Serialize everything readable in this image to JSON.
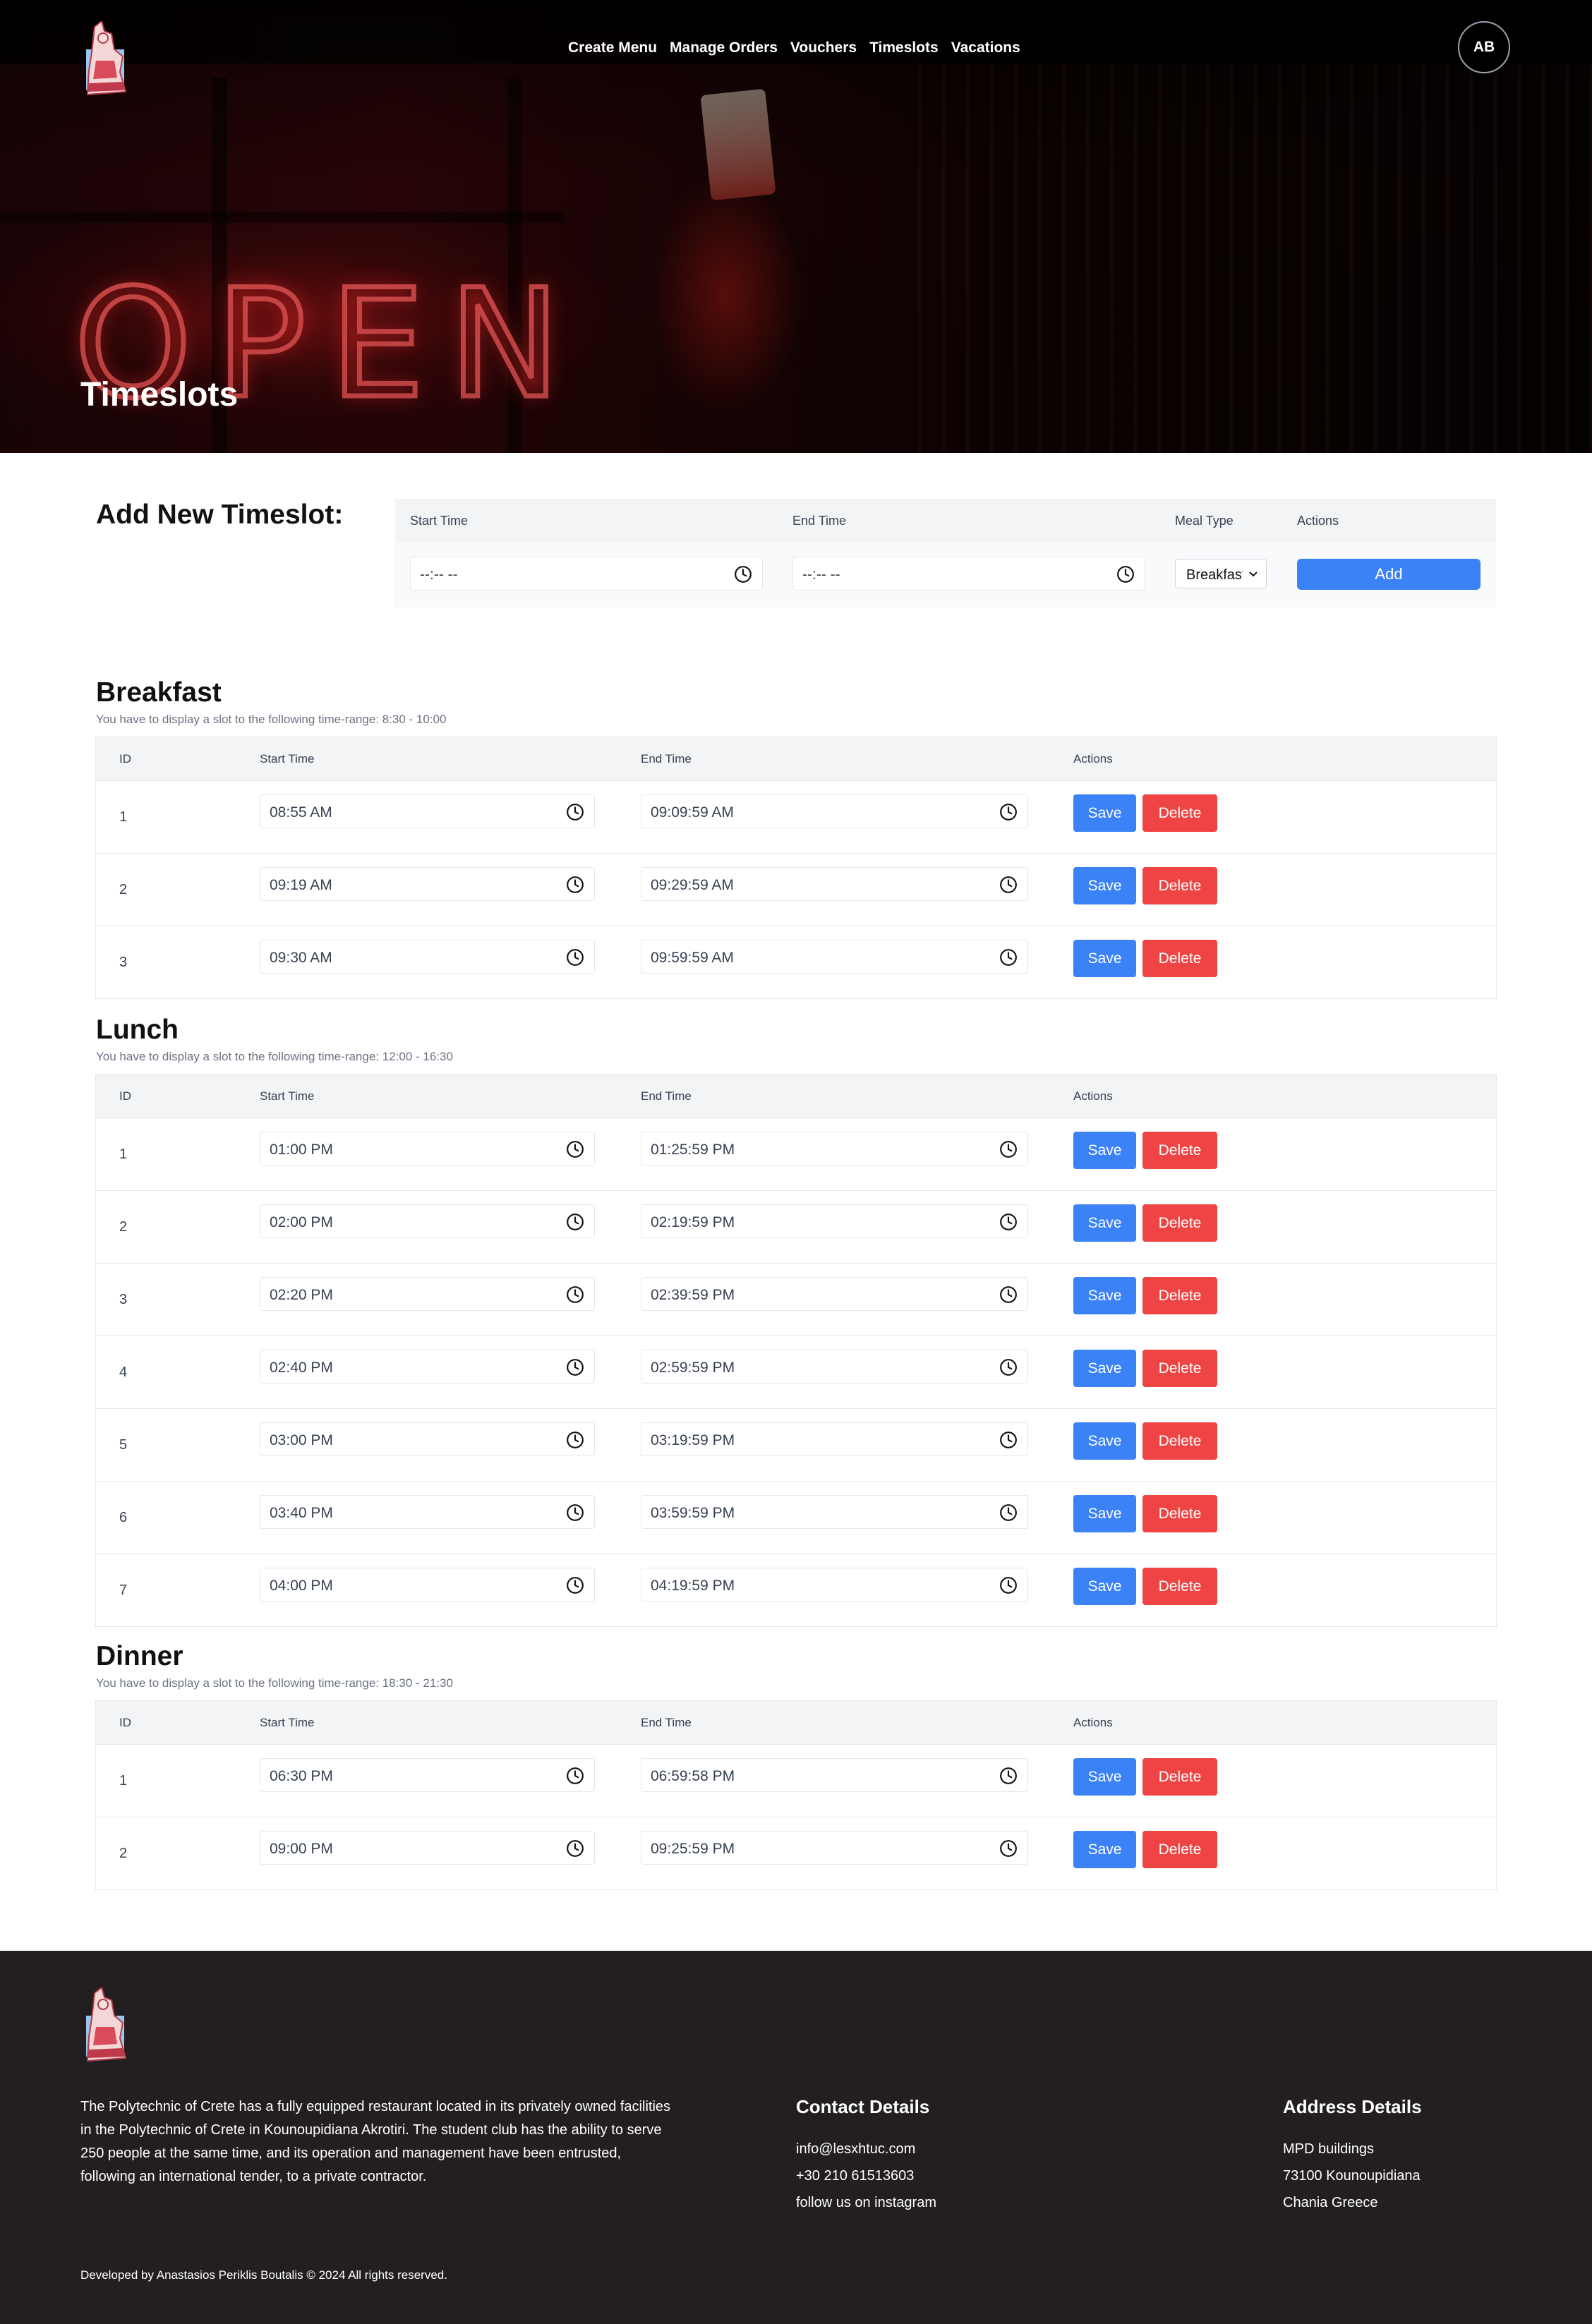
{
  "nav": {
    "items": [
      "Create Menu",
      "Manage Orders",
      "Vouchers",
      "Timeslots",
      "Vacations"
    ],
    "avatar_initials": "AB"
  },
  "hero": {
    "title": "Timeslots"
  },
  "add_form": {
    "title": "Add New Timeslot:",
    "headers": {
      "start": "Start Time",
      "end": "End Time",
      "meal": "Meal Type",
      "actions": "Actions"
    },
    "start_value": "--:-- --",
    "end_value": "--:-- --",
    "meal_value": "Breakfast",
    "add_label": "Add"
  },
  "table_headers": {
    "id": "ID",
    "start": "Start Time",
    "end": "End Time",
    "actions": "Actions"
  },
  "buttons": {
    "save": "Save",
    "delete": "Delete"
  },
  "sections": [
    {
      "title": "Breakfast",
      "subtitle": "You have to display a slot to the following time-range: 8:30 - 10:00",
      "rows": [
        {
          "id": "1",
          "start": "08:55 AM",
          "end": "09:09:59 AM"
        },
        {
          "id": "2",
          "start": "09:19 AM",
          "end": "09:29:59 AM"
        },
        {
          "id": "3",
          "start": "09:30 AM",
          "end": "09:59:59 AM"
        }
      ]
    },
    {
      "title": "Lunch",
      "subtitle": "You have to display a slot to the following time-range: 12:00 - 16:30",
      "rows": [
        {
          "id": "1",
          "start": "01:00 PM",
          "end": "01:25:59 PM"
        },
        {
          "id": "2",
          "start": "02:00 PM",
          "end": "02:19:59 PM"
        },
        {
          "id": "3",
          "start": "02:20 PM",
          "end": "02:39:59 PM"
        },
        {
          "id": "4",
          "start": "02:40 PM",
          "end": "02:59:59 PM"
        },
        {
          "id": "5",
          "start": "03:00 PM",
          "end": "03:19:59 PM"
        },
        {
          "id": "6",
          "start": "03:40 PM",
          "end": "03:59:59 PM"
        },
        {
          "id": "7",
          "start": "04:00 PM",
          "end": "04:19:59 PM"
        }
      ]
    },
    {
      "title": "Dinner",
      "subtitle": "You have to display a slot to the following time-range: 18:30 - 21:30",
      "rows": [
        {
          "id": "1",
          "start": "06:30 PM",
          "end": "06:59:58 PM"
        },
        {
          "id": "2",
          "start": "09:00 PM",
          "end": "09:25:59 PM"
        }
      ]
    }
  ],
  "footer": {
    "about": "The Polytechnic of Crete has a fully equipped restaurant located in its privately owned facilities in the Polytechnic of Crete in Kounoupidiana Akrotiri. The student club has the ability to serve 250 people at the same time, and its operation and management have been entrusted, following an international tender, to a private contractor.",
    "contact_title": "Contact Details",
    "contact": [
      "info@lesxhtuc.com",
      "+30 210 61513603",
      "follow us on instagram"
    ],
    "address_title": "Address Details",
    "address": [
      "MPD buildings",
      "73100 Kounoupidiana",
      "Chania Greece"
    ],
    "copyright": "Developed by Anastasios Periklis Boutalis © 2024 All rights reserved."
  }
}
